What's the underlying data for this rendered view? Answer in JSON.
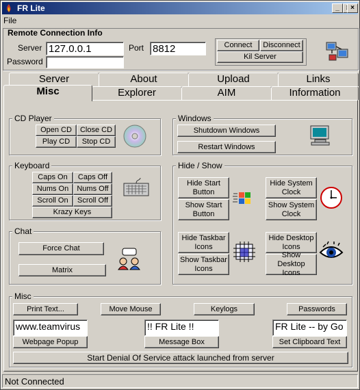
{
  "window": {
    "title": "FR Lite",
    "controls": [
      "_",
      "□",
      "×"
    ]
  },
  "menu": {
    "file": "File"
  },
  "remote": {
    "title": "Remote Connection Info",
    "server_label": "Server",
    "server_value": "127.0.0.1",
    "port_label": "Port",
    "port_value": "8812",
    "password_label": "Password",
    "password_value": "",
    "connect": "Connect",
    "disconnect": "Disconnect",
    "kill_server": "Kil Server"
  },
  "tabs": {
    "row1": [
      "Server",
      "About",
      "Upload",
      "Links"
    ],
    "row2": [
      "Misc",
      "Explorer",
      "AIM",
      "Information"
    ],
    "active": "Misc"
  },
  "cd": {
    "title": "CD Player",
    "open": "Open CD",
    "close": "Close CD",
    "play": "Play CD",
    "stop": "Stop CD"
  },
  "windows": {
    "title": "Windows",
    "shutdown": "Shutdown Windows",
    "restart": "Restart Windows"
  },
  "keyboard": {
    "title": "Keyboard",
    "caps_on": "Caps On",
    "caps_off": "Caps Off",
    "nums_on": "Nums On",
    "nums_off": "Nums Off",
    "scroll_on": "Scroll On",
    "scroll_off": "Scroll Off",
    "krazy": "Krazy Keys"
  },
  "hideshow": {
    "title": "Hide / Show",
    "hide_start": "Hide Start Button",
    "show_start": "Show Start Button",
    "hide_clock": "Hide System Clock",
    "show_clock": "Show System Clock",
    "hide_taskbar": "Hide Taskbar Icons",
    "show_taskbar": "Show Taskbar Icons",
    "hide_desktop": "Hide Desktop Icons",
    "show_desktop": "Show Desktop Icons"
  },
  "chat": {
    "title": "Chat",
    "force": "Force Chat",
    "matrix": "Matrix"
  },
  "misc": {
    "title": "Misc",
    "print": "Print Text...",
    "move_mouse": "Move Mouse",
    "keylogs": "Keylogs",
    "passwords": "Passwords",
    "webpage_value": "www.teamvirus",
    "webpage_btn": "Webpage Popup",
    "message_value": "!! FR Lite !!",
    "message_btn": "Message Box",
    "clipboard_value": "FR Lite -- by Go",
    "clipboard_btn": "Set Clipboard Text",
    "dos": "Start Denial Of Service attack launched from server"
  },
  "status": {
    "text": "Not Connected"
  }
}
